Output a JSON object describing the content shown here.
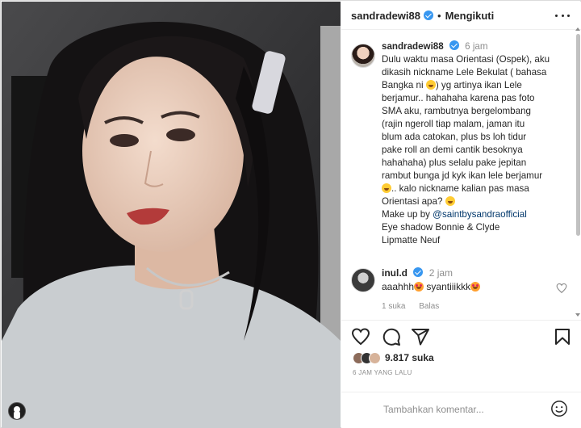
{
  "header": {
    "username": "sandradewi88",
    "separator": "•",
    "follow_label": "Mengikuti"
  },
  "caption": {
    "username": "sandradewi88",
    "time": "6 jam",
    "lines": [
      "Dulu waktu masa Orientasi (Ospek), aku",
      "dikasih nickname Lele Bekulat ( bahasa",
      "Bangka ni",
      ") yg artinya ikan Lele",
      "berjamur.. hahahaha karena pas foto",
      "SMA aku, rambutnya bergelombang",
      "(rajin ngeroll tiap malam, jaman itu",
      "blum ada catokan, plus bs loh tidur",
      "pake roll an demi cantik besoknya",
      "hahahaha) plus selalu pake jepitan",
      "rambut bunga jd kyk ikan lele berjamur",
      ".. kalo nickname kalian pas masa",
      "Orientasi apa?",
      "Make up by",
      "@saintbysandraofficial",
      "Eye shadow Bonnie & Clyde",
      "Lipmatte Neuf"
    ]
  },
  "reply": {
    "username": "inul.d",
    "time": "2 jam",
    "text_a": "aaahhh",
    "text_b": "syantiiikkk",
    "likes": "1 suka",
    "reply_label": "Balas"
  },
  "actions": {
    "likes_count": "9.817 suka",
    "post_time": "6 JAM YANG LALU"
  },
  "comment": {
    "placeholder": "Tambahkan komentar..."
  },
  "icons": {
    "more": "more-horizontal-icon",
    "like": "heart-icon",
    "comment": "comment-icon",
    "share": "send-icon",
    "save": "bookmark-icon",
    "emoji": "smiley-icon"
  },
  "colors": {
    "verified": "#3897f0",
    "text": "#262626",
    "muted": "#8e8e8e",
    "mention": "#00376b"
  }
}
